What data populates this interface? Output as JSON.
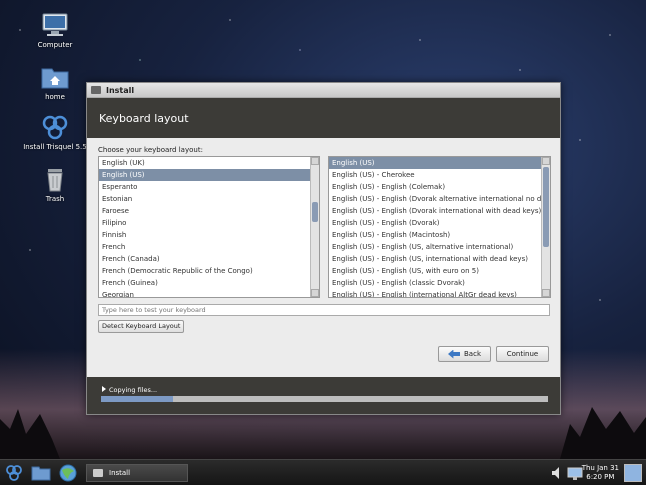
{
  "desktop": {
    "icons": [
      {
        "label": "Computer",
        "icon": "computer-icon"
      },
      {
        "label": "home",
        "icon": "home-folder-icon"
      },
      {
        "label": "Install Trisquel 5.5",
        "icon": "trisquel-logo-icon"
      },
      {
        "label": "Trash",
        "icon": "trash-icon"
      }
    ]
  },
  "window": {
    "title": "Install",
    "header": "Keyboard layout",
    "choose_label": "Choose your keyboard layout:",
    "layouts": [
      "English (UK)",
      "English (US)",
      "Esperanto",
      "Estonian",
      "Faroese",
      "Filipino",
      "Finnish",
      "French",
      "French (Canada)",
      "French (Democratic Republic of the Congo)",
      "French (Guinea)",
      "Georgian"
    ],
    "selected_layout": "English (US)",
    "variants": [
      "English (US)",
      "English (US) - Cherokee",
      "English (US) - English (Colemak)",
      "English (US) - English (Dvorak alternative international no dead keys)",
      "English (US) - English (Dvorak international with dead keys)",
      "English (US) - English (Dvorak)",
      "English (US) - English (Macintosh)",
      "English (US) - English (US, alternative international)",
      "English (US) - English (US, international with dead keys)",
      "English (US) - English (US, with euro on 5)",
      "English (US) - English (classic Dvorak)",
      "English (US) - English (international AltGr dead keys)"
    ],
    "selected_variant": "English (US)",
    "test_placeholder": "Type here to test your keyboard",
    "detect_button": "Detect Keyboard Layout",
    "back_button": "Back",
    "continue_button": "Continue",
    "progress_label": "Copying files...",
    "progress_fraction": 0.16
  },
  "taskbar": {
    "task_label": "Install",
    "clock_day": "Thu Jan 31",
    "clock_time": "6:20 PM"
  },
  "colors": {
    "header_bg": "#3c3b37",
    "selection": "#7d8fa6",
    "progress_fill": "#7d9ac4"
  }
}
